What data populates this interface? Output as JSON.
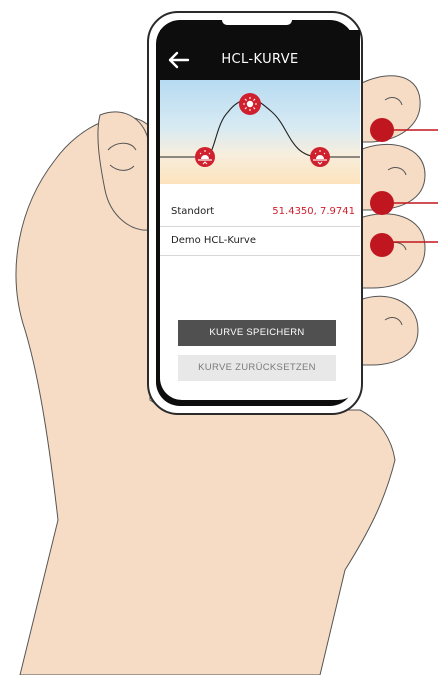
{
  "header": {
    "title": "HCL-KURVE"
  },
  "settings": {
    "location": {
      "label": "Standort",
      "value": "51.4350, 7.9741"
    },
    "curve_name": "Demo HCL-Kurve"
  },
  "buttons": {
    "save": "KURVE SPEICHERN",
    "reset": "KURVE ZURÜCKSETZEN"
  },
  "colors": {
    "accent": "#d0202e",
    "header_bg": "#0d0d0d",
    "save_button_bg": "#505050",
    "reset_button_bg": "#e8e8e8"
  },
  "icons": [
    "back-arrow-icon",
    "sunrise-icon",
    "sun-icon",
    "sunset-icon"
  ]
}
